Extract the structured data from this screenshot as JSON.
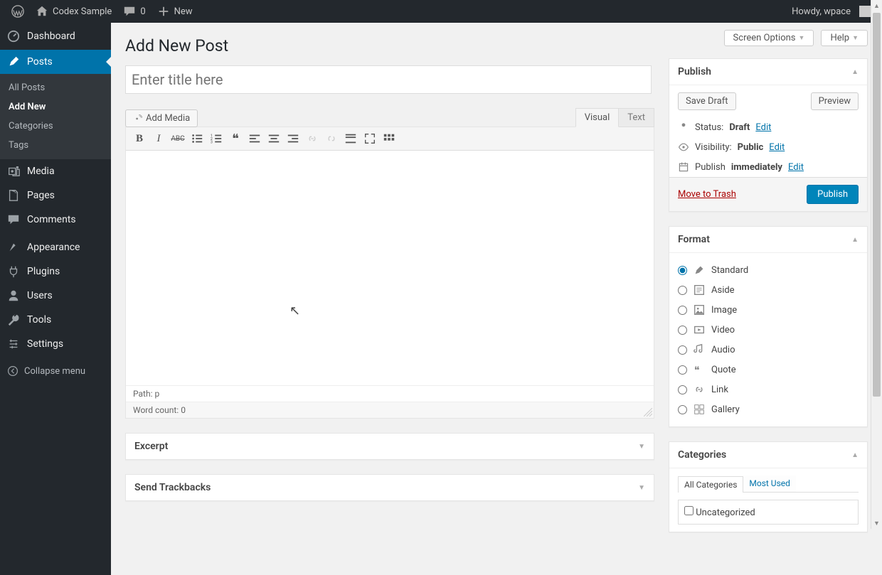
{
  "adminbar": {
    "site_name": "Codex Sample",
    "comments_count": "0",
    "new_label": "New",
    "howdy": "Howdy, wpace"
  },
  "sidebar": {
    "dashboard": "Dashboard",
    "posts": "Posts",
    "posts_sub": {
      "all": "All Posts",
      "add_new": "Add New",
      "categories": "Categories",
      "tags": "Tags"
    },
    "media": "Media",
    "pages": "Pages",
    "comments": "Comments",
    "appearance": "Appearance",
    "plugins": "Plugins",
    "users": "Users",
    "tools": "Tools",
    "settings": "Settings",
    "collapse": "Collapse menu"
  },
  "top_buttons": {
    "screen_options": "Screen Options",
    "help": "Help"
  },
  "page_title": "Add New Post",
  "title_placeholder": "Enter title here",
  "editor": {
    "add_media": "Add Media",
    "tab_visual": "Visual",
    "tab_text": "Text",
    "path_label": "Path:",
    "path_value": "p",
    "wordcount_label": "Word count:",
    "wordcount_value": "0"
  },
  "boxes": {
    "excerpt": "Excerpt",
    "trackbacks": "Send Trackbacks"
  },
  "publish": {
    "title": "Publish",
    "save_draft": "Save Draft",
    "preview": "Preview",
    "status_label": "Status:",
    "status_value": "Draft",
    "visibility_label": "Visibility:",
    "visibility_value": "Public",
    "publish_label": "Publish",
    "publish_value": "immediately",
    "edit": "Edit",
    "trash": "Move to Trash",
    "publish_btn": "Publish"
  },
  "format": {
    "title": "Format",
    "items": [
      "Standard",
      "Aside",
      "Image",
      "Video",
      "Audio",
      "Quote",
      "Link",
      "Gallery"
    ],
    "selected": 0
  },
  "categories": {
    "title": "Categories",
    "tab_all": "All Categories",
    "tab_most": "Most Used",
    "item": "Uncategorized"
  }
}
